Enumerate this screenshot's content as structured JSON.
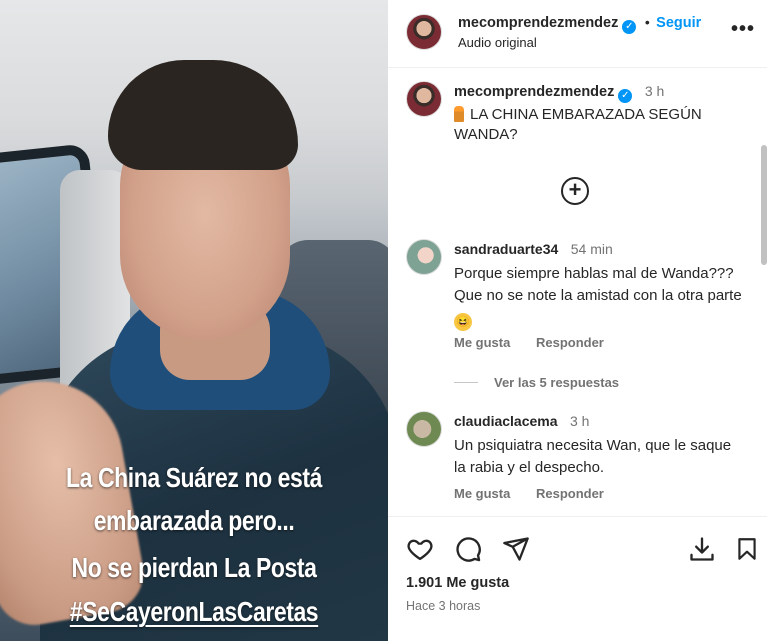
{
  "video": {
    "caption_lines": [
      "La China Suárez no está",
      "embarazada pero...",
      "No se pierdan La Posta",
      "#SeCayeronLasCaretas"
    ]
  },
  "header": {
    "username": "mecomprendezmendez",
    "separator": "•",
    "follow_label": "Seguir",
    "subtitle": "Audio original",
    "more_icon": "more-horizontal-icon"
  },
  "caption": {
    "username": "mecomprendezmendez",
    "time": "3 h",
    "text": "LA CHINA EMBARAZADA SEGÚN WANDA?"
  },
  "comments": [
    {
      "username": "sandraduarte34",
      "time": "54 min",
      "text": "Porque siempre hablas mal de Wanda??? Que no se note la amistad con la otra parte",
      "like_label": "Me gusta",
      "reply_label": "Responder"
    },
    {
      "username": "claudiaclacema",
      "time": "3 h",
      "text": "Un psiquiatra necesita Wan, que le saque la rabia y el despecho.",
      "like_label": "Me gusta",
      "reply_label": "Responder"
    }
  ],
  "view_replies_label": "Ver las 5 respuestas",
  "footer": {
    "likes": "1.901 Me gusta",
    "posted": "Hace 3 horas"
  },
  "colors": {
    "accent": "#0095f6",
    "text": "#262626",
    "muted": "#737373"
  }
}
